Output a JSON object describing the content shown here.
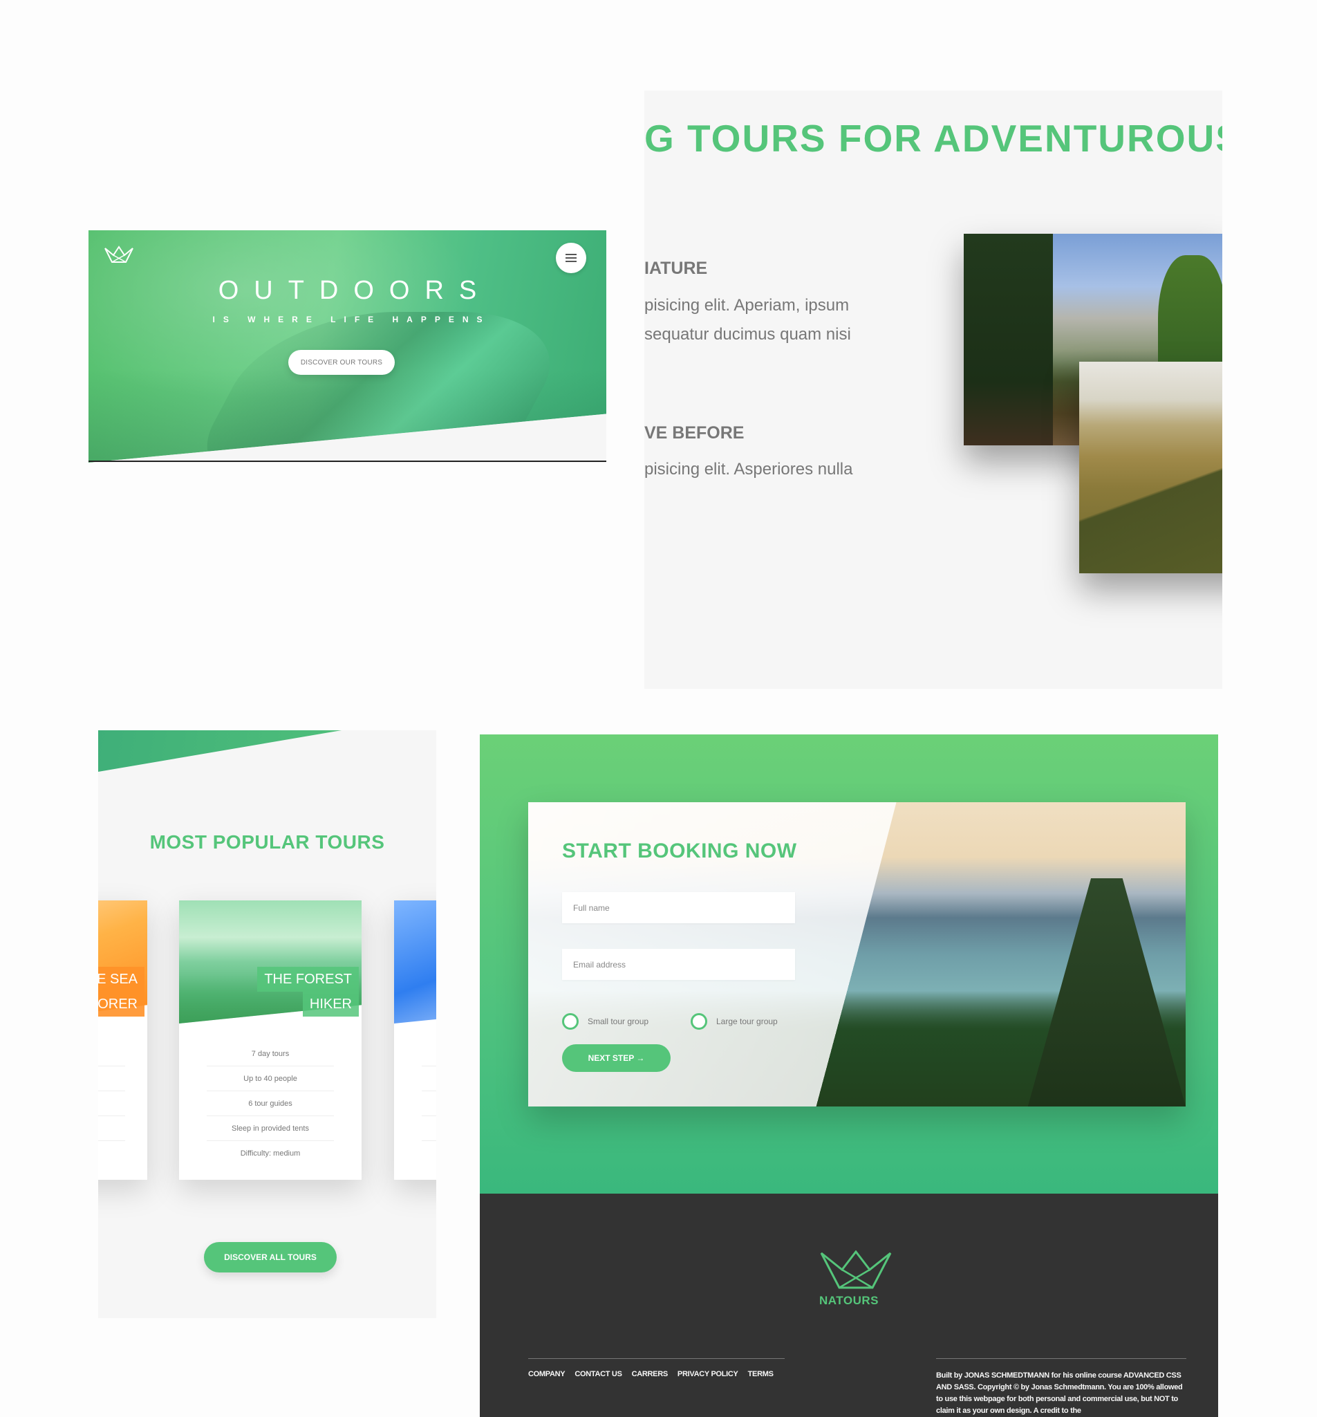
{
  "hero": {
    "title": "OUTDOORS",
    "subtitle": "IS WHERE LIFE HAPPENS",
    "cta_label": "DISCOVER OUR TOURS"
  },
  "about": {
    "heading": "G TOURS FOR ADVENTUROUS",
    "feature_1_title": "IATURE",
    "feature_1_line_1": "pisicing elit. Aperiam, ipsum",
    "feature_1_line_2": "sequatur ducimus quam nisi",
    "feature_2_title": "VE BEFORE",
    "feature_2_line_1": "pisicing elit. Asperiores nulla"
  },
  "tours": {
    "title": "MOST POPULAR TOURS",
    "cards": [
      {
        "heading_line_1": "E SEA",
        "heading_line_2": "ORER"
      },
      {
        "heading_line_1": "THE FOREST",
        "heading_line_2": "HIKER",
        "details": [
          "7 day tours",
          "Up to 40 people",
          "6 tour guides",
          "Sleep in provided tents",
          "Difficulty: medium"
        ]
      }
    ],
    "cta_label": "DISCOVER ALL TOURS"
  },
  "booking": {
    "title": "START BOOKING NOW",
    "full_name_placeholder": "Full name",
    "email_placeholder": "Email address",
    "radio_small": "Small tour group",
    "radio_large": "Large tour group",
    "next_label": "NEXT STEP →"
  },
  "footer": {
    "brand": "NATOURS",
    "nav": [
      "COMPANY",
      "CONTACT US",
      "CARRERS",
      "PRIVACY POLICY",
      "TERMS"
    ],
    "copyright": "Built by JONAS SCHMEDTMANN for his online course ADVANCED CSS AND SASS. Copyright © by Jonas Schmedtmann. You are 100% allowed to use this webpage for both personal and commercial use, but NOT to claim it as your own design. A credit to the"
  },
  "colors": {
    "primary": "#55c57a",
    "primary_dark": "#3ab87d",
    "footer_bg": "#333333",
    "section_bg": "#f6f6f6"
  }
}
